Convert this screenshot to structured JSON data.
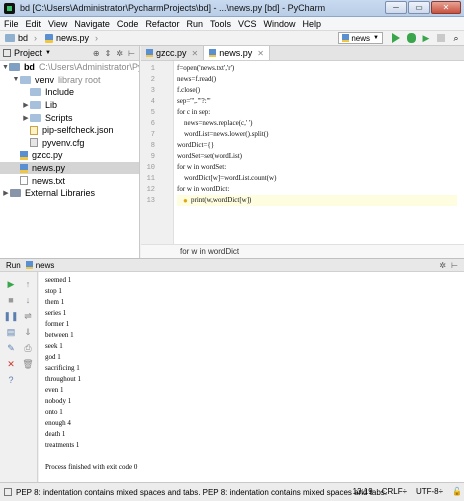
{
  "window": {
    "title": "bd [C:\\Users\\Administrator\\PycharmProjects\\bd] - ...\\news.py [bd] - PyCharm",
    "buttons": [
      "─",
      "▭",
      "✕"
    ]
  },
  "menu": [
    "File",
    "Edit",
    "View",
    "Navigate",
    "Code",
    "Refactor",
    "Run",
    "Tools",
    "VCS",
    "Window",
    "Help"
  ],
  "navbar": {
    "project": "bd",
    "file": "news.py",
    "run_config": "news"
  },
  "project_panel": {
    "title": "Project",
    "tree": [
      {
        "label": "bd",
        "extra": "C:\\Users\\Administrator\\Pycha",
        "icon": "folder"
      },
      {
        "label": "venv",
        "extra": "library root",
        "icon": "folder"
      },
      {
        "label": "Include",
        "extra": "",
        "icon": "folder"
      },
      {
        "label": "Lib",
        "extra": "",
        "icon": "folder"
      },
      {
        "label": "Scripts",
        "extra": "",
        "icon": "folder"
      },
      {
        "label": "pip-selfcheck.json",
        "extra": "",
        "icon": "json"
      },
      {
        "label": "pyvenv.cfg",
        "extra": "",
        "icon": "cfg"
      },
      {
        "label": "gzcc.py",
        "extra": "",
        "icon": "py"
      },
      {
        "label": "news.py",
        "extra": "",
        "icon": "py"
      },
      {
        "label": "news.txt",
        "extra": "",
        "icon": "txt"
      },
      {
        "label": "External Libraries",
        "extra": "",
        "icon": "lib"
      }
    ]
  },
  "tabs": [
    {
      "label": "gzcc.py",
      "active": false
    },
    {
      "label": "news.py",
      "active": true
    }
  ],
  "editor": {
    "line_numbers": [
      "1",
      "2",
      "3",
      "4",
      "5",
      "6",
      "7",
      "8",
      "9",
      "10",
      "11",
      "12",
      "13"
    ],
    "lines": [
      "f=open('news.txt','r')",
      "news=f.read()",
      "f.close()",
      "sep=''',.'\"?:'''",
      "for c in sep:",
      "    news=news.replace(c,' ')",
      "    wordList=news.lower().split()",
      "wordDict={}",
      "wordSet=set(wordList)",
      "for w in wordSet:",
      "    wordDict[w]=wordList.count(w)",
      "for w in wordDict:",
      "        print(w,wordDict[w])"
    ],
    "breadcrumb": "for w in wordDict"
  },
  "run_panel": {
    "label": "Run",
    "config": "news",
    "output": [
      "seemed 1",
      "stop 1",
      "them 1",
      "series 1",
      "former 1",
      "between 1",
      "seek 1",
      "god 1",
      "sacrificing 1",
      "throughout 1",
      "even 1",
      "nobody 1",
      "onto 1",
      "enough 4",
      "death 1",
      "treatments 1",
      "",
      "Process finished with exit code 0"
    ]
  },
  "statusbar": {
    "message": "PEP 8: indentation contains mixed spaces and tabs. PEP 8: indentation contains mixed spaces and tabs.",
    "position": "13:19",
    "line_sep": "CRLF÷",
    "encoding": "UTF-8÷"
  }
}
